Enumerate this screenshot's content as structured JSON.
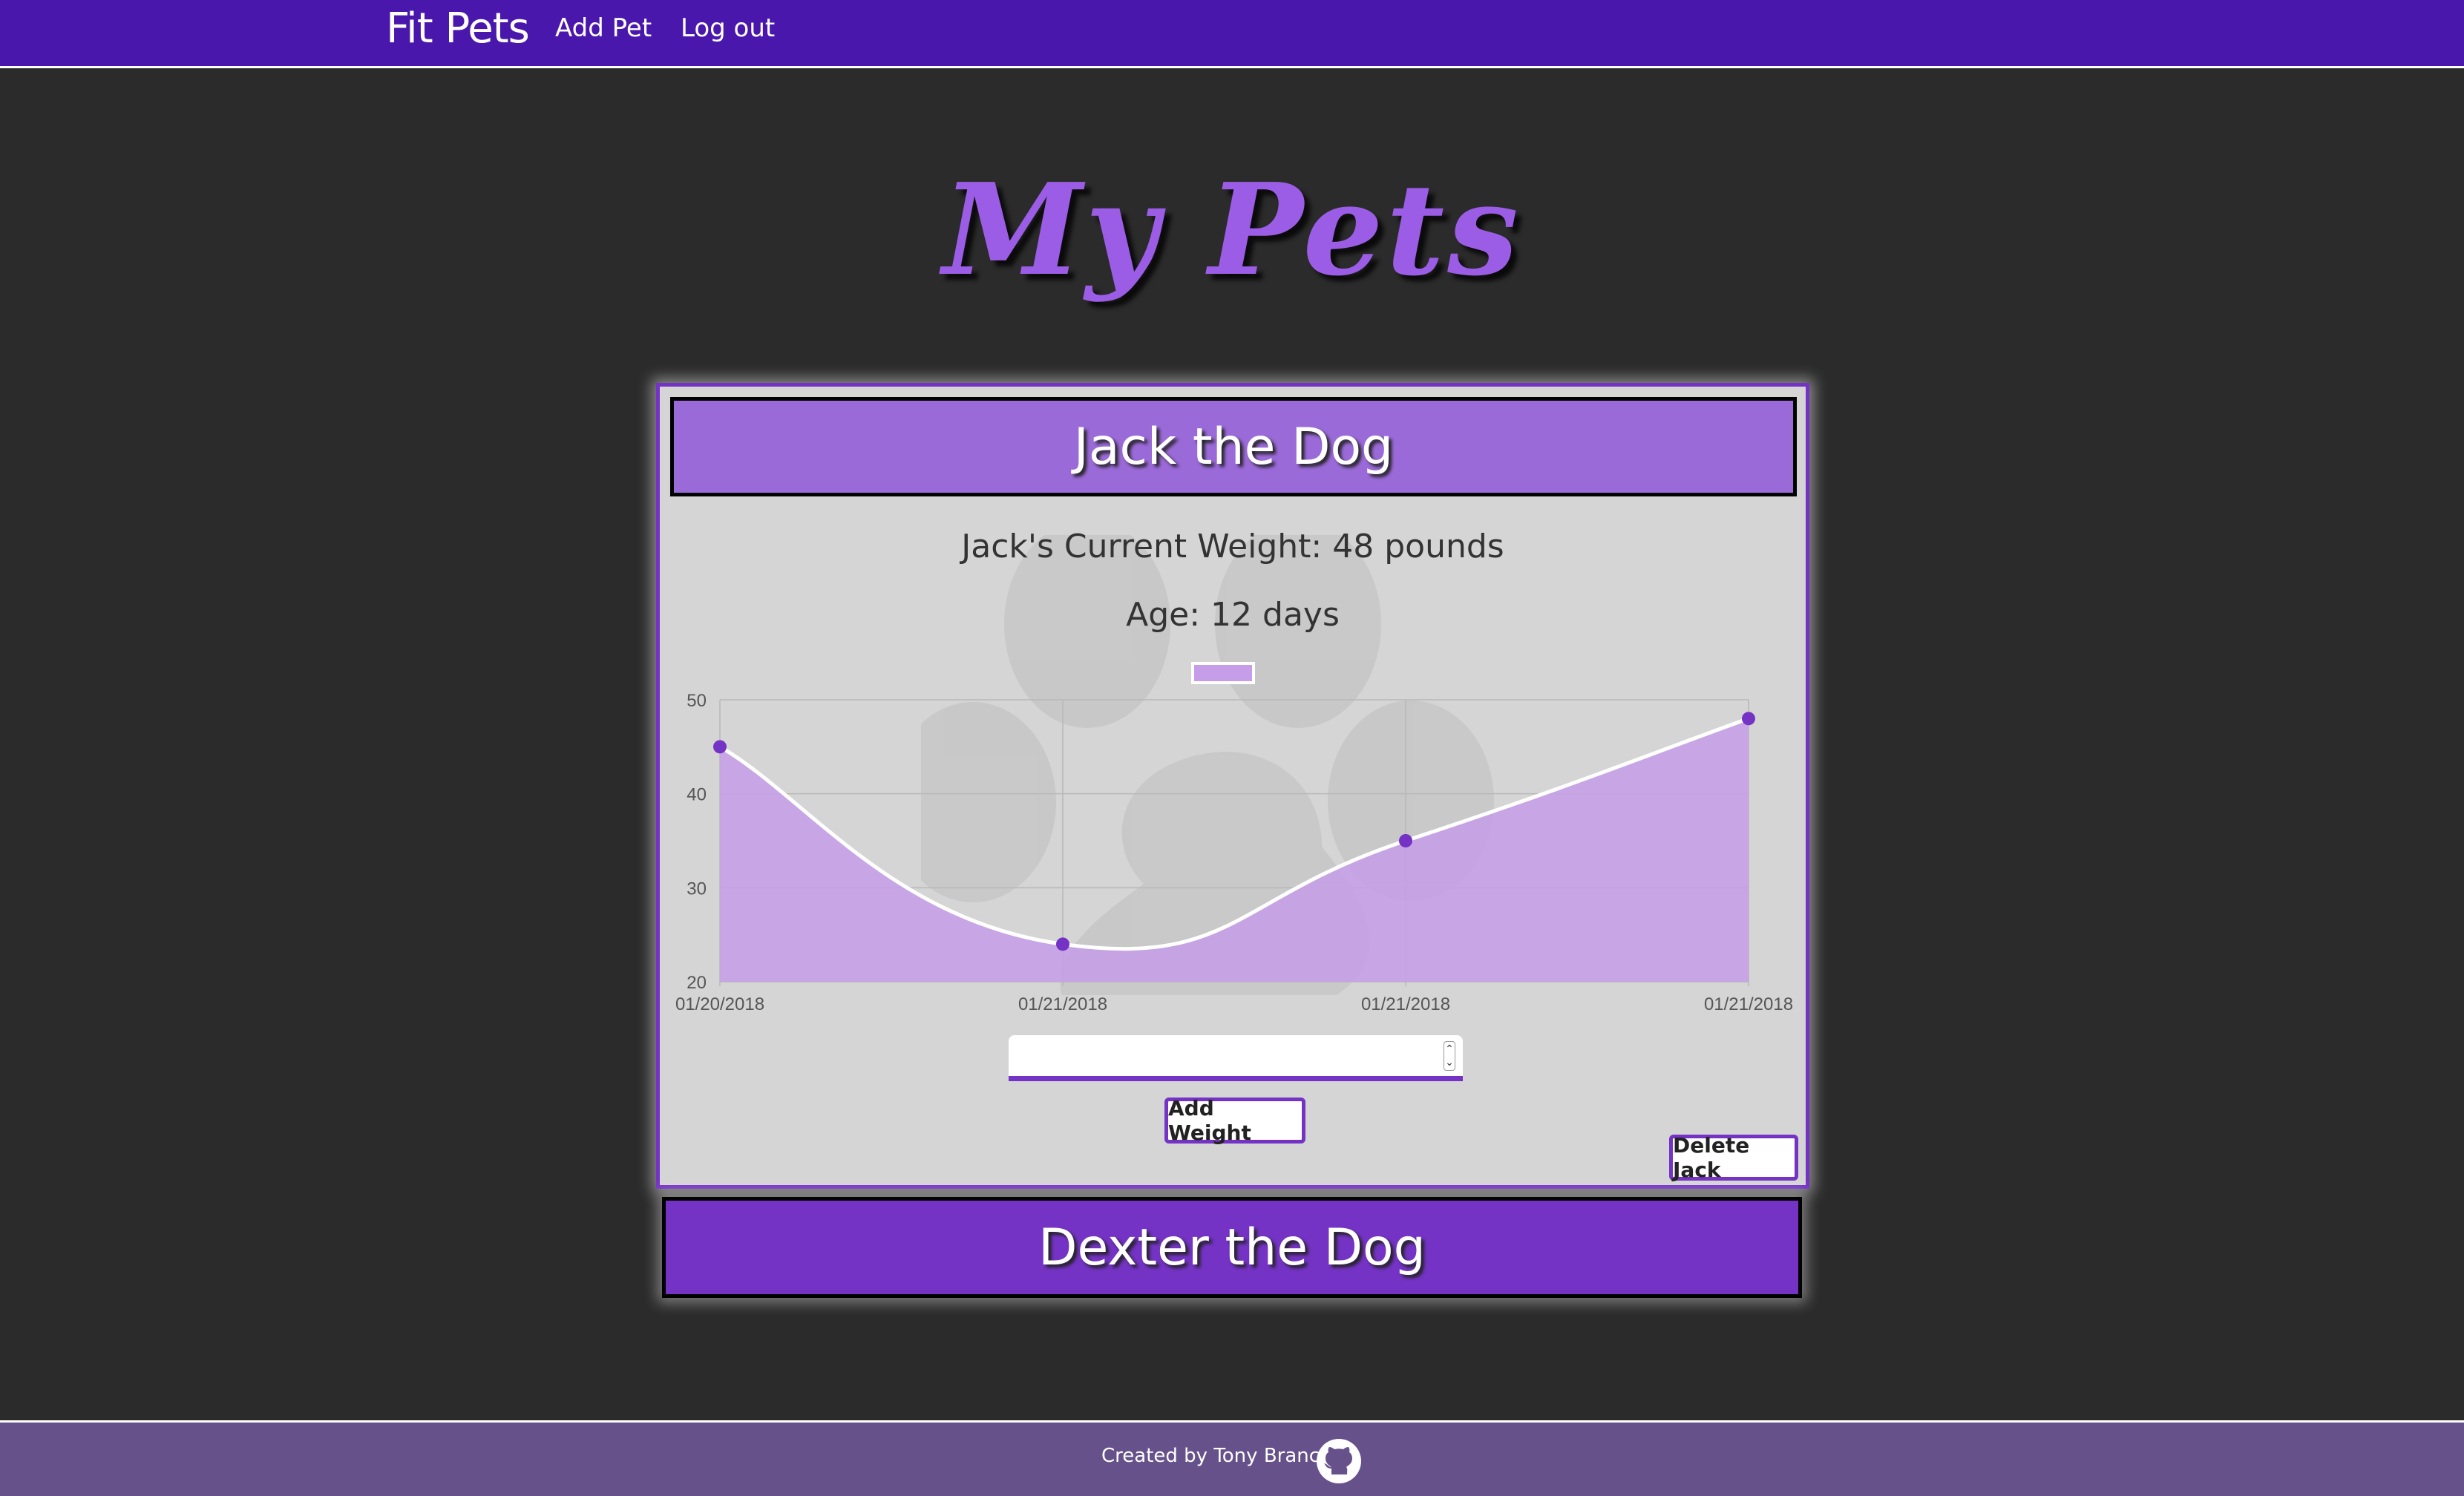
{
  "navbar": {
    "brand": "Fit Pets",
    "add_pet": "Add Pet",
    "log_out": "Log out",
    "background": "#4a17ad"
  },
  "page": {
    "title": "My Pets",
    "title_color": "#9b5de5",
    "background": "#2b2b2b"
  },
  "pets": [
    {
      "header": "Jack the Dog",
      "current_weight": "Jack's Current Weight: 48 pounds",
      "age": "Age: 12 days",
      "add_weight_label": "Add Weight",
      "delete_label": "Delete Jack",
      "weight_input_value": "",
      "header_color": "#9b6ad9"
    },
    {
      "header": "Dexter the Dog",
      "header_color": "#7433c4"
    }
  ],
  "chart_data": {
    "type": "area",
    "x": [
      "01/20/2018",
      "01/21/2018",
      "01/21/2018",
      "01/21/2018"
    ],
    "values": [
      45,
      24,
      35,
      48
    ],
    "ylim": [
      20,
      50
    ],
    "yticks": [
      20,
      30,
      40,
      50
    ],
    "grid": true,
    "legend": "top-center",
    "series_color": "#c59de8",
    "line_color": "#ffffff",
    "point_color": "#7433c4"
  },
  "footer": {
    "text": "Created by Tony Brancato",
    "background": "#67518b",
    "icon": "github-icon"
  }
}
